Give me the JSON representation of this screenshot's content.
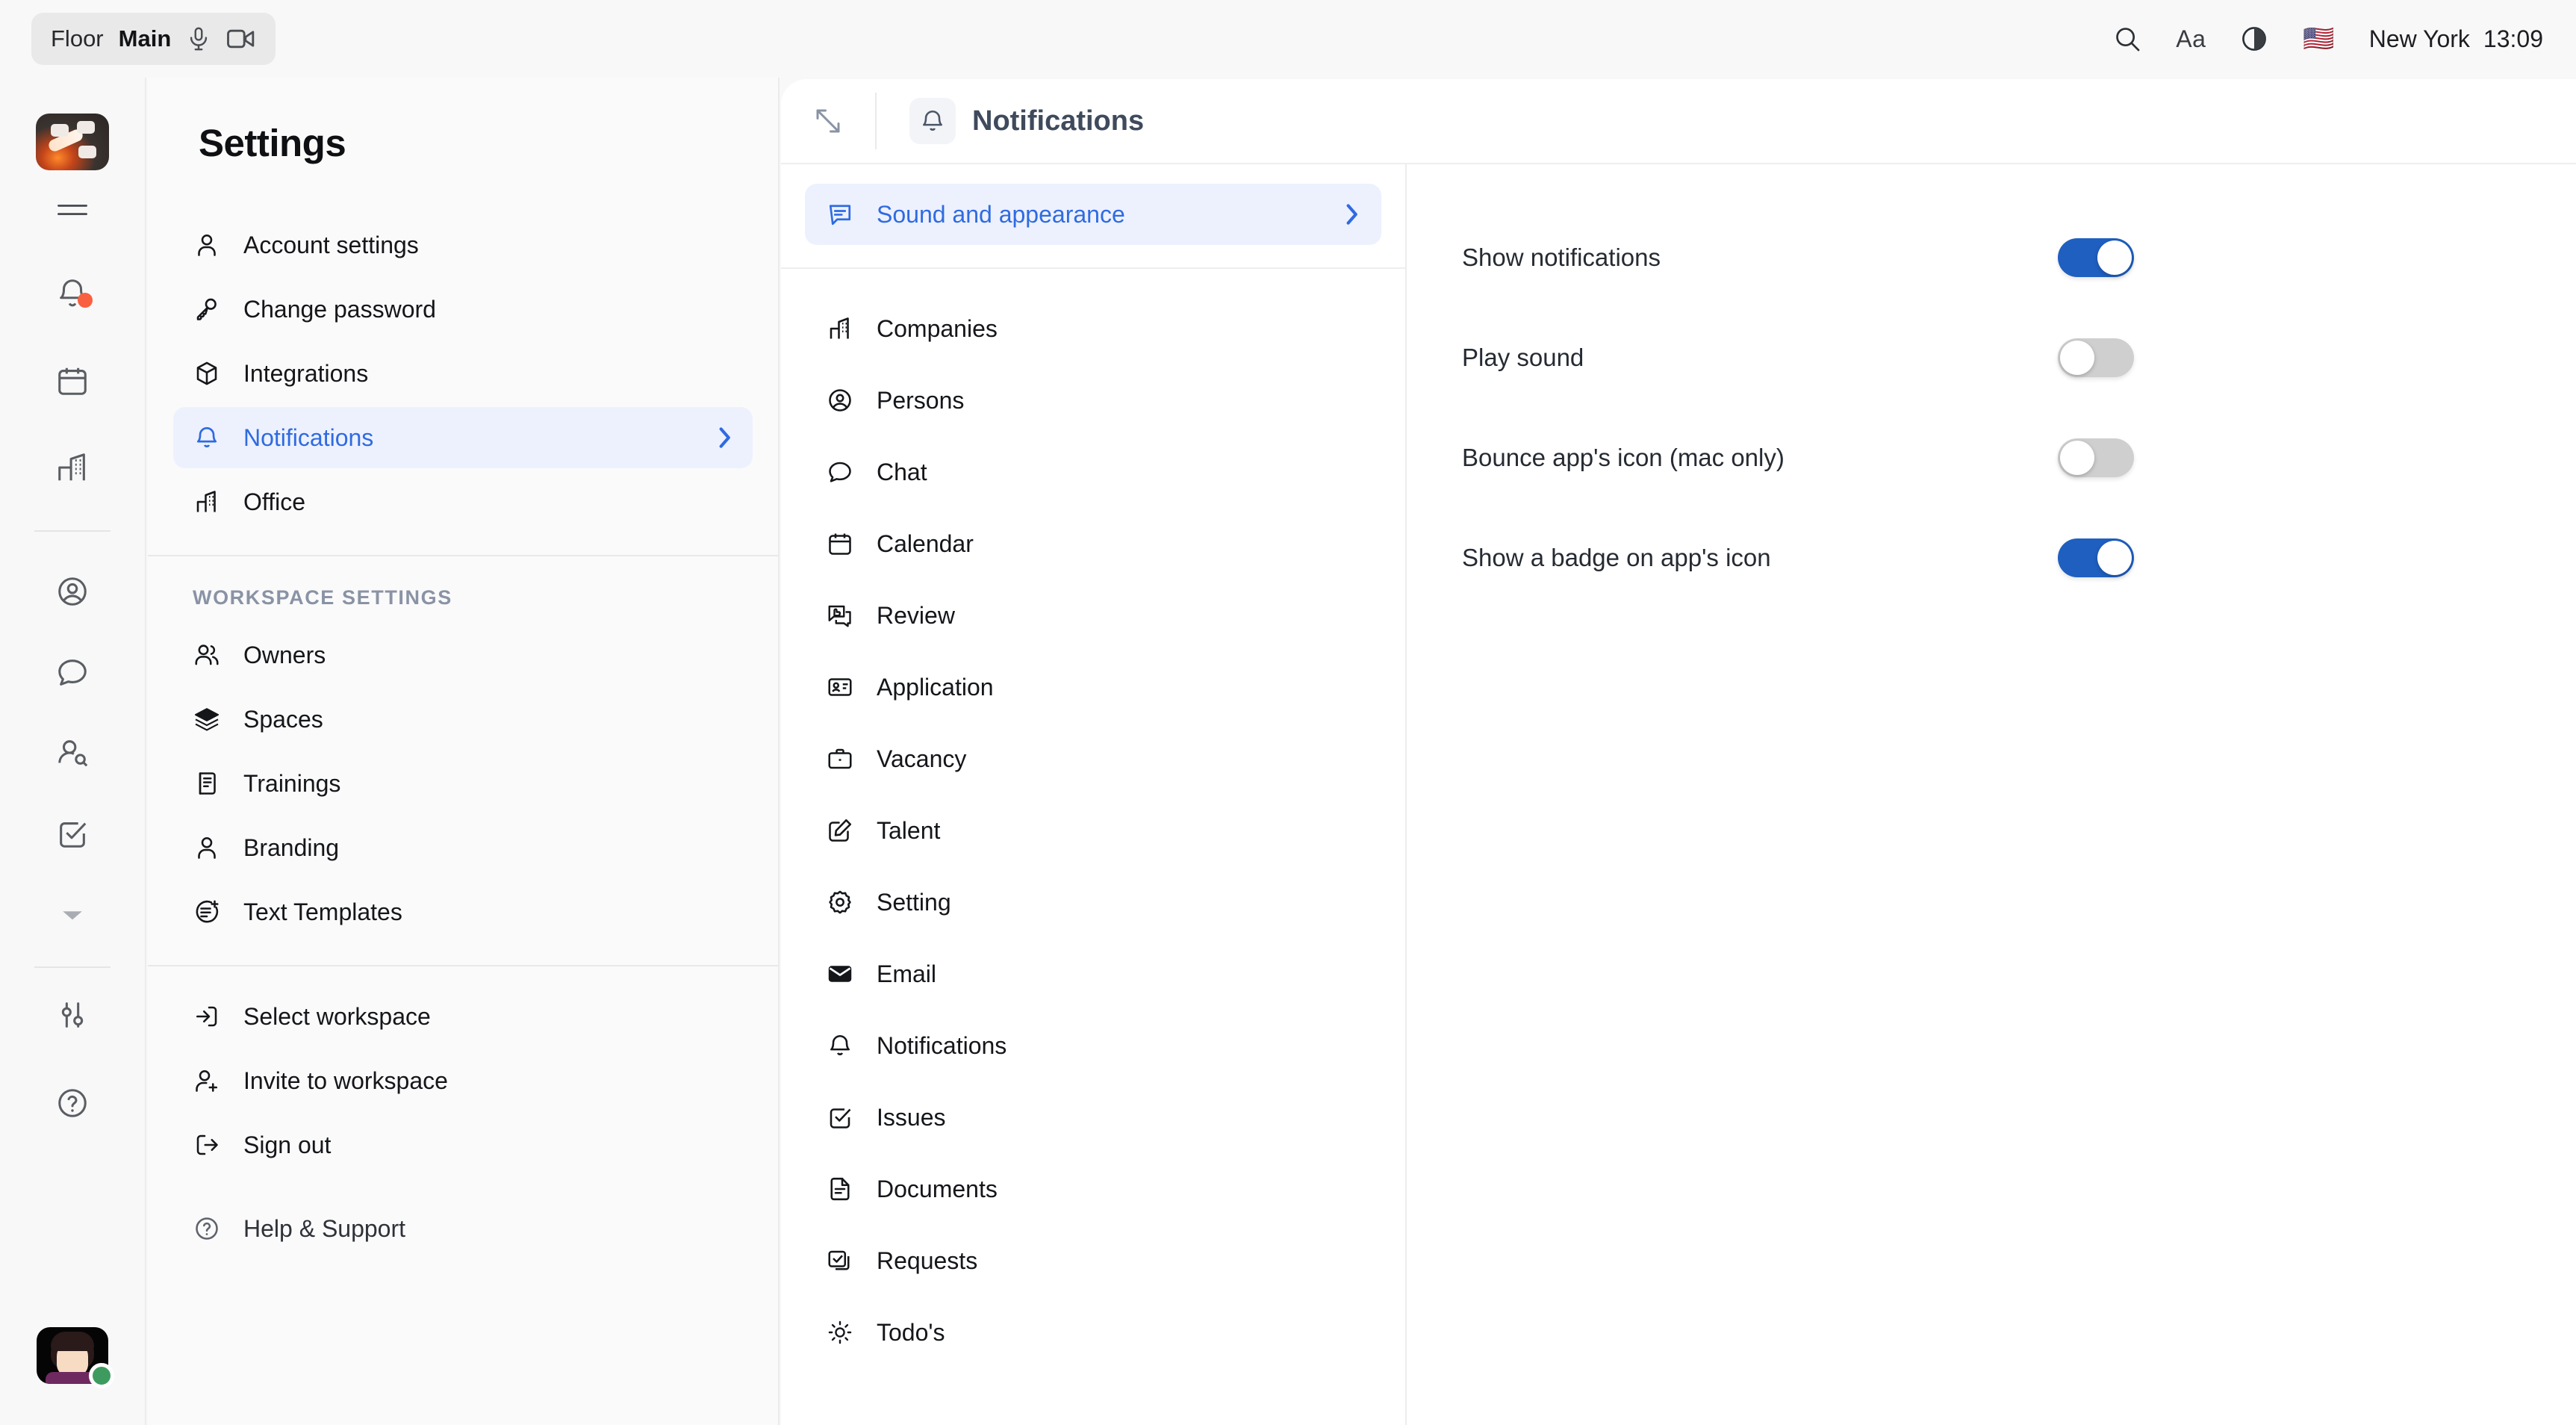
{
  "topbar": {
    "floor_label": "Floor",
    "floor_value": "Main",
    "mic_icon": "microphone-icon",
    "camera_icon": "video-camera-icon",
    "search_icon": "search-icon",
    "font_size_label": "Aa",
    "contrast_icon": "contrast-icon",
    "flag": "🇺🇸",
    "city": "New York",
    "time": "13:09"
  },
  "rail": {
    "logo_name": "app-logo",
    "items": [
      {
        "name": "menu-icon",
        "badge": false
      },
      {
        "name": "bell-icon",
        "badge": true
      },
      {
        "name": "calendar-icon",
        "badge": false
      },
      {
        "name": "office-building-icon",
        "badge": false
      },
      {
        "name": "user-circle-icon",
        "badge": false
      },
      {
        "name": "chat-bubble-icon",
        "badge": false
      },
      {
        "name": "user-search-icon",
        "badge": false
      },
      {
        "name": "check-square-icon",
        "badge": false
      },
      {
        "name": "chevron-down-icon",
        "badge": false
      },
      {
        "name": "sliders-icon",
        "badge": false
      },
      {
        "name": "help-circle-icon",
        "badge": false
      }
    ],
    "avatar_name": "user-avatar",
    "avatar_status": "online"
  },
  "settings": {
    "title": "Settings",
    "account_items": [
      {
        "label": "Account settings",
        "icon": "person-icon",
        "active": false,
        "chevron": false
      },
      {
        "label": "Change password",
        "icon": "key-icon",
        "active": false,
        "chevron": false
      },
      {
        "label": "Integrations",
        "icon": "cube-icon",
        "active": false,
        "chevron": false
      },
      {
        "label": "Notifications",
        "icon": "bell-icon",
        "active": true,
        "chevron": true
      },
      {
        "label": "Office",
        "icon": "office-building-icon",
        "active": false,
        "chevron": false
      }
    ],
    "workspace_heading": "WORKSPACE SETTINGS",
    "workspace_items": [
      {
        "label": "Owners",
        "icon": "people-icon"
      },
      {
        "label": "Spaces",
        "icon": "layers-icon"
      },
      {
        "label": "Trainings",
        "icon": "training-doc-icon"
      },
      {
        "label": "Branding",
        "icon": "person-icon"
      },
      {
        "label": "Text Templates",
        "icon": "document-plus-icon"
      }
    ],
    "account_actions": [
      {
        "label": "Select workspace",
        "icon": "login-arrow-icon"
      },
      {
        "label": "Invite to workspace",
        "icon": "person-plus-icon"
      },
      {
        "label": "Sign out",
        "icon": "logout-arrow-icon"
      }
    ],
    "help_item": {
      "label": "Help & Support",
      "icon": "help-circle-icon"
    }
  },
  "main": {
    "collapse_icon": "collapse-diagonal-icon",
    "header_icon": "bell-icon",
    "header_title": "Notifications",
    "section_row": {
      "label": "Sound and appearance",
      "icon": "message-lines-icon",
      "active": true,
      "chevron": "chevron-right-icon"
    },
    "categories": [
      {
        "label": "Companies",
        "icon": "office-building-icon"
      },
      {
        "label": "Persons",
        "icon": "user-circle-icon"
      },
      {
        "label": "Chat",
        "icon": "chat-bubble-icon"
      },
      {
        "label": "Calendar",
        "icon": "calendar-icon"
      },
      {
        "label": "Review",
        "icon": "review-thumbsup-icon"
      },
      {
        "label": "Application",
        "icon": "id-card-icon"
      },
      {
        "label": "Vacancy",
        "icon": "briefcase-icon"
      },
      {
        "label": "Talent",
        "icon": "edit-square-icon"
      },
      {
        "label": "Setting",
        "icon": "gear-icon"
      },
      {
        "label": "Email",
        "icon": "envelope-icon"
      },
      {
        "label": "Notifications",
        "icon": "bell-icon"
      },
      {
        "label": "Issues",
        "icon": "check-square-icon"
      },
      {
        "label": "Documents",
        "icon": "document-icon"
      },
      {
        "label": "Requests",
        "icon": "check-square-stack-icon"
      },
      {
        "label": "Todo's",
        "icon": "sun-icon"
      }
    ],
    "toggles": [
      {
        "label": "Show notifications",
        "on": true
      },
      {
        "label": "Play sound",
        "on": false
      },
      {
        "label": "Bounce app's icon (mac only)",
        "on": false
      },
      {
        "label": "Show a badge on app's icon",
        "on": true
      }
    ]
  },
  "colors": {
    "accent_blue": "#2F6BE0",
    "toggle_on": "#1F5FC0",
    "toggle_off": "#CFCFCF",
    "active_bg": "#EDF1FE",
    "badge_red": "#F9603F",
    "status_green": "#3E9B60"
  }
}
